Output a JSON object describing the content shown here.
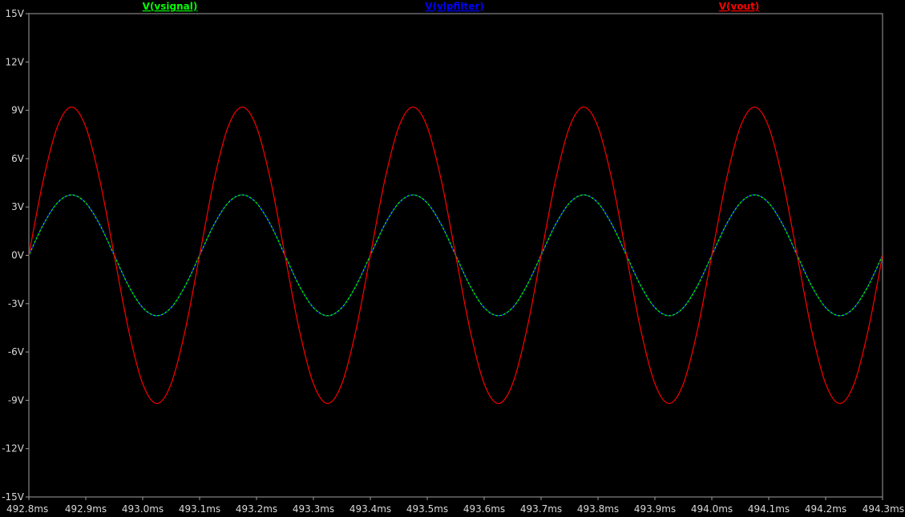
{
  "chart_data": {
    "type": "line",
    "title": "",
    "xlabel": "",
    "ylabel": "",
    "xlim": [
      492.8,
      494.3
    ],
    "ylim": [
      -15,
      15
    ],
    "x_ticks": [
      "492.8ms",
      "492.9ms",
      "493.0ms",
      "493.1ms",
      "493.2ms",
      "493.3ms",
      "493.4ms",
      "493.5ms",
      "493.6ms",
      "493.7ms",
      "493.8ms",
      "493.9ms",
      "494.0ms",
      "494.1ms",
      "494.2ms",
      "494.3ms"
    ],
    "y_ticks": [
      "15V",
      "12V",
      "9V",
      "6V",
      "3V",
      "0V",
      "-3V",
      "-6V",
      "-9V",
      "-12V",
      "-15V"
    ],
    "grid": false,
    "legend_placement": "top",
    "colors": {
      "background": "#000000",
      "axis": "#a0a0a0",
      "tick_text": "#d8d8d8"
    },
    "series": [
      {
        "name": "V(vsignal)",
        "color": "#00ff00",
        "x": [
          492.8,
          492.825,
          492.85,
          492.875,
          492.9,
          492.925,
          492.95,
          492.975,
          493.0,
          493.025,
          493.05,
          493.075,
          493.1,
          493.125,
          493.15,
          493.175,
          493.2,
          493.225,
          493.25,
          493.275,
          493.3,
          493.325,
          493.35,
          493.375,
          493.4,
          493.425,
          493.45,
          493.475,
          493.5,
          493.525,
          493.55,
          493.575,
          493.6,
          493.625,
          493.65,
          493.675,
          493.7,
          493.725,
          493.75,
          493.775,
          493.8,
          493.825,
          493.85,
          493.875,
          493.9,
          493.925,
          493.95,
          493.975,
          494.0,
          494.025,
          494.05,
          494.075,
          494.1,
          494.125,
          494.15,
          494.175,
          494.2,
          494.225,
          494.25,
          494.275,
          494.3
        ],
        "y": [
          0.0,
          1.88,
          3.25,
          3.75,
          3.25,
          1.88,
          0.0,
          -1.88,
          -3.25,
          -3.75,
          -3.25,
          -1.88,
          0.0,
          1.88,
          3.25,
          3.75,
          3.25,
          1.88,
          0.0,
          -1.88,
          -3.25,
          -3.75,
          -3.25,
          -1.88,
          0.0,
          1.88,
          3.25,
          3.75,
          3.25,
          1.88,
          0.0,
          -1.88,
          -3.25,
          -3.75,
          -3.25,
          -1.88,
          0.0,
          1.88,
          3.25,
          3.75,
          3.25,
          1.88,
          0.0,
          -1.88,
          -3.25,
          -3.75,
          -3.25,
          -1.88,
          0.0,
          1.88,
          3.25,
          3.75,
          3.25,
          1.88,
          0.0,
          -1.88,
          -3.25,
          -3.75,
          -3.25,
          -1.88,
          0.0
        ]
      },
      {
        "name": "V(vlpfilter)",
        "color": "#0000ff",
        "x": [
          492.8,
          492.825,
          492.85,
          492.875,
          492.9,
          492.925,
          492.95,
          492.975,
          493.0,
          493.025,
          493.05,
          493.075,
          493.1,
          493.125,
          493.15,
          493.175,
          493.2,
          493.225,
          493.25,
          493.275,
          493.3,
          493.325,
          493.35,
          493.375,
          493.4,
          493.425,
          493.45,
          493.475,
          493.5,
          493.525,
          493.55,
          493.575,
          493.6,
          493.625,
          493.65,
          493.675,
          493.7,
          493.725,
          493.75,
          493.775,
          493.8,
          493.825,
          493.85,
          493.875,
          493.9,
          493.925,
          493.95,
          493.975,
          494.0,
          494.025,
          494.05,
          494.075,
          494.1,
          494.125,
          494.15,
          494.175,
          494.2,
          494.225,
          494.25,
          494.275,
          494.3
        ],
        "y": [
          0.0,
          1.88,
          3.25,
          3.75,
          3.25,
          1.88,
          0.0,
          -1.88,
          -3.25,
          -3.75,
          -3.25,
          -1.88,
          0.0,
          1.88,
          3.25,
          3.75,
          3.25,
          1.88,
          0.0,
          -1.88,
          -3.25,
          -3.75,
          -3.25,
          -1.88,
          0.0,
          1.88,
          3.25,
          3.75,
          3.25,
          1.88,
          0.0,
          -1.88,
          -3.25,
          -3.75,
          -3.25,
          -1.88,
          0.0,
          1.88,
          3.25,
          3.75,
          3.25,
          1.88,
          0.0,
          -1.88,
          -3.25,
          -3.75,
          -3.25,
          -1.88,
          0.0,
          1.88,
          3.25,
          3.75,
          3.25,
          1.88,
          0.0,
          -1.88,
          -3.25,
          -3.75,
          -3.25,
          -1.88,
          0.0
        ]
      },
      {
        "name": "V(vout)",
        "color": "#ff0000",
        "x": [
          492.8,
          492.825,
          492.85,
          492.875,
          492.9,
          492.925,
          492.95,
          492.975,
          493.0,
          493.025,
          493.05,
          493.075,
          493.1,
          493.125,
          493.15,
          493.175,
          493.2,
          493.225,
          493.25,
          493.275,
          493.3,
          493.325,
          493.35,
          493.375,
          493.4,
          493.425,
          493.45,
          493.475,
          493.5,
          493.525,
          493.55,
          493.575,
          493.6,
          493.625,
          493.65,
          493.675,
          493.7,
          493.725,
          493.75,
          493.775,
          493.8,
          493.825,
          493.85,
          493.875,
          493.9,
          493.925,
          493.95,
          493.975,
          494.0,
          494.025,
          494.05,
          494.075,
          494.1,
          494.125,
          494.15,
          494.175,
          494.2,
          494.225,
          494.25,
          494.275,
          494.3
        ],
        "y": [
          0.0,
          4.6,
          7.97,
          9.2,
          7.97,
          4.6,
          0.0,
          -4.6,
          -7.97,
          -9.2,
          -7.97,
          -4.6,
          0.0,
          4.6,
          7.97,
          9.2,
          7.97,
          4.6,
          0.0,
          -4.6,
          -7.97,
          -9.2,
          -7.97,
          -4.6,
          0.0,
          4.6,
          7.97,
          9.2,
          7.97,
          4.6,
          0.0,
          -4.6,
          -7.97,
          -9.2,
          -7.97,
          -4.6,
          0.0,
          4.6,
          7.97,
          9.2,
          7.97,
          4.6,
          0.0,
          -4.6,
          -7.97,
          -9.2,
          -7.97,
          -4.6,
          0.0,
          4.6,
          7.97,
          9.2,
          7.97,
          4.6,
          0.0,
          -4.6,
          -7.97,
          -9.2,
          -7.97,
          -4.6,
          0.0
        ]
      }
    ]
  }
}
